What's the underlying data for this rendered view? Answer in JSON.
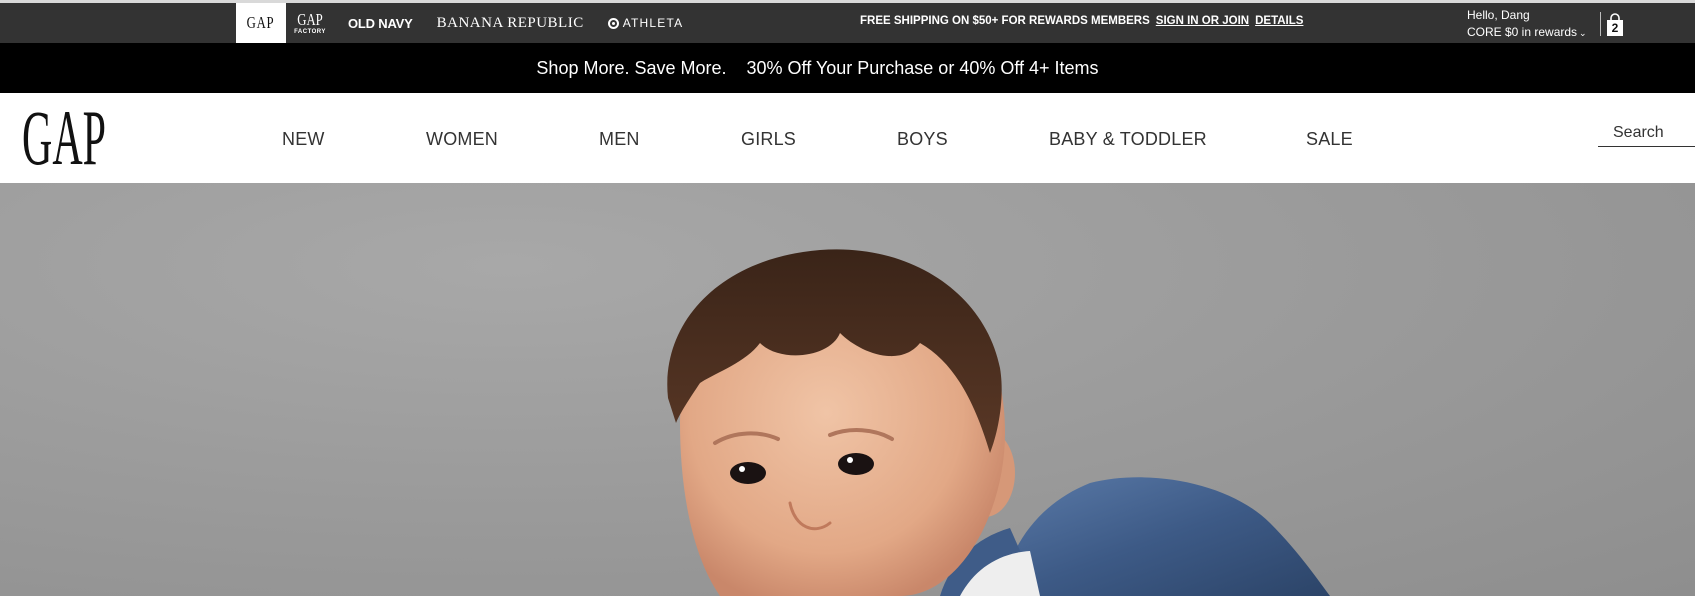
{
  "brand_bar": {
    "brands": [
      {
        "id": "gap",
        "label": "GAP"
      },
      {
        "id": "gapfactory",
        "label": "GAP",
        "sublabel": "FACTORY"
      },
      {
        "id": "oldnavy",
        "label": "OLD NAVY"
      },
      {
        "id": "bananarepublic",
        "label": "BANANA REPUBLIC"
      },
      {
        "id": "athleta",
        "label": "ATHLETA"
      }
    ],
    "shipping_text": "FREE SHIPPING ON $50+ FOR REWARDS MEMBERS",
    "sign_in_link": "SIGN IN OR JOIN",
    "details_link": "DETAILS",
    "account_greeting": "Hello, Dang",
    "account_rewards": "CORE $0 in rewards",
    "bag_count": "2"
  },
  "promo": {
    "line1": "Shop More. Save More.",
    "line2": "30% Off Your Purchase or 40% Off 4+ Items"
  },
  "header": {
    "logo": "GAP",
    "nav": [
      "NEW",
      "WOMEN",
      "MEN",
      "GIRLS",
      "BOYS",
      "BABY & TODDLER",
      "SALE"
    ],
    "search_placeholder": "Search"
  },
  "colors": {
    "topbar": "#333333",
    "promo": "#000000",
    "annotation_arrow": "#e53935"
  }
}
